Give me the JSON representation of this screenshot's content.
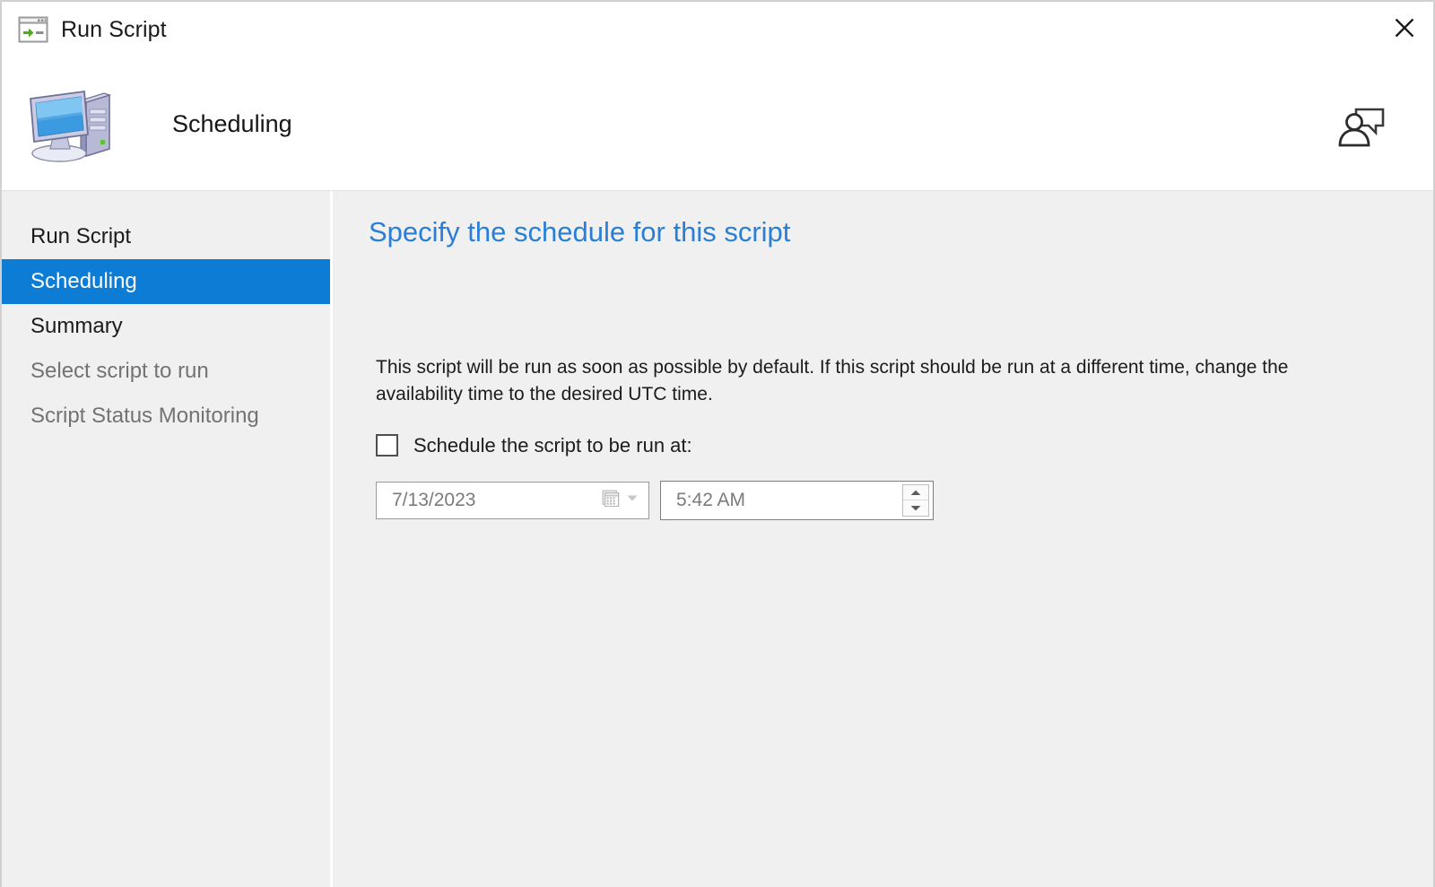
{
  "window": {
    "title": "Run Script",
    "title_icon": "run-script-window-icon",
    "close_label": "✕"
  },
  "banner": {
    "title": "Scheduling",
    "icon": "computer-icon",
    "feedback_icon": "send-feedback-icon"
  },
  "sidebar": {
    "items": [
      {
        "label": "Run Script",
        "state": "normal"
      },
      {
        "label": "Scheduling",
        "state": "selected"
      },
      {
        "label": "Summary",
        "state": "normal"
      },
      {
        "label": "Select script to run",
        "state": "muted"
      },
      {
        "label": "Script Status Monitoring",
        "state": "muted"
      }
    ]
  },
  "content": {
    "heading": "Specify the schedule for this script",
    "description": "This script will be run as soon as possible by default. If this script should be run at a different time, change the availability time to the desired UTC time.",
    "checkbox": {
      "label": "Schedule the script to be run at:",
      "checked": false
    },
    "date_field": {
      "value": "7/13/2023",
      "placeholder": "M/d/yyyy",
      "calendar_icon": "calendar-icon",
      "dropdown_icon": "chevron-down-icon"
    },
    "time_field": {
      "value": "5:42 AM",
      "placeholder": "h:mm tt",
      "spinner_up_icon": "spinner-up-icon",
      "spinner_down_icon": "spinner-down-icon"
    }
  },
  "colors": {
    "accent_blue": "#0c7cd5",
    "heading_blue": "#2a7fd4",
    "surface": "#f0f0f0",
    "muted_text": "#737373"
  }
}
